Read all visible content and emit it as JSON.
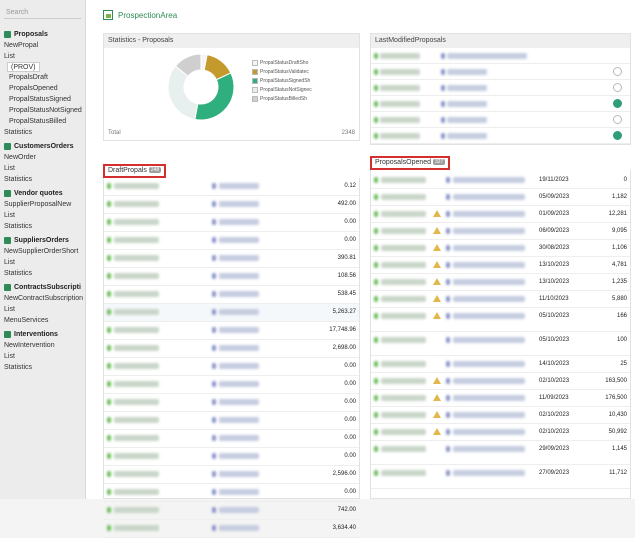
{
  "search_placeholder": "Search",
  "sidebar": {
    "proposals_title": "Proposals",
    "new_propal": "NewPropal",
    "list": "List",
    "prov": "(PROV)",
    "propals_draft": "PropalsDraft",
    "propals_opened": "PropalsOpened",
    "propal_status_signed": "PropalStatusSigned",
    "propal_status_not_signed": "PropalStatusNotSigned",
    "propal_status_billed": "PropalStatusBilled",
    "statistics1": "Statistics",
    "customer_orders_title": "CustomersOrders",
    "new_order": "NewOrder",
    "list2": "List",
    "statistics2": "Statistics",
    "vendor_quotes_title": "Vendor quotes",
    "supplier_proposal_new": "SupplierProposalNew",
    "list3": "List",
    "statistics3": "Statistics",
    "suppliers_orders_title": "SuppliersOrders",
    "new_supplier_order_short": "NewSupplierOrderShort",
    "list4": "List",
    "statistics4": "Statistics",
    "contracts_title": "ContractsSubscripti",
    "new_contract": "NewContractSubscription",
    "list5": "List",
    "menu_services": "MenuServices",
    "interventions_title": "Interventions",
    "new_intervention": "NewIntervention",
    "list6": "List",
    "statistics6": "Statistics"
  },
  "page_title": "ProspectionArea",
  "stats_card": {
    "title": "Statistics - Proposals",
    "total_label": "Total",
    "total_value": "2348",
    "legend": [
      {
        "label": "PropalStatusDraftSho",
        "color": "#f4f4f4"
      },
      {
        "label": "PropalStatusValidatec",
        "color": "#c59a2c"
      },
      {
        "label": "PropalStatusSignedSh",
        "color": "#2fae7e"
      },
      {
        "label": "PropalStatusNotSignec",
        "color": "#e8f0ef"
      },
      {
        "label": "PropalStatusBilledSh",
        "color": "#cfcfcf"
      }
    ],
    "slices": [
      {
        "label": "PropalStatusDraftSho",
        "value": 0.03
      },
      {
        "label": "PropalStatusValidatec",
        "value": 0.15
      },
      {
        "label": "PropalStatusSignedSh",
        "value": 0.35
      },
      {
        "label": "PropalStatusNotSignec",
        "value": 0.33
      },
      {
        "label": "PropalStatusBilledSh",
        "value": 0.14
      }
    ]
  },
  "last_modified": {
    "title": "LastModifiedProposals"
  },
  "draft": {
    "title": "DraftPropals",
    "count": "248",
    "values": [
      "0.12",
      "492.00",
      "0.00",
      "0.00",
      "390.81",
      "108.56",
      "538.45",
      "5,263.27",
      "17,748.96",
      "2,698.00",
      "0.00",
      "0.00",
      "0.00",
      "0.00",
      "0.00",
      "0.00",
      "2,596.00",
      "0.00",
      "742.00",
      "3,634.40"
    ]
  },
  "opened": {
    "title": "ProposalsOpened",
    "count": "327",
    "dates": [
      "19/11/2023",
      "05/09/2023",
      "01/09/2023",
      "06/09/2023",
      "30/08/2023",
      "13/10/2023",
      "13/10/2023",
      "11/10/2023",
      "05/10/2023",
      "05/10/2023",
      "14/10/2023",
      "02/10/2023",
      "11/09/2023",
      "02/10/2023",
      "02/10/2023",
      "29/09/2023",
      "27/09/2023"
    ],
    "amounts": [
      "0",
      "1,182",
      "12,281",
      "9,095",
      "1,106",
      "4,781",
      "1,235",
      "5,880",
      "166",
      "100",
      "25",
      "163,500",
      "176,500",
      "10,430",
      "50,992",
      "1,145",
      "11,712"
    ]
  }
}
